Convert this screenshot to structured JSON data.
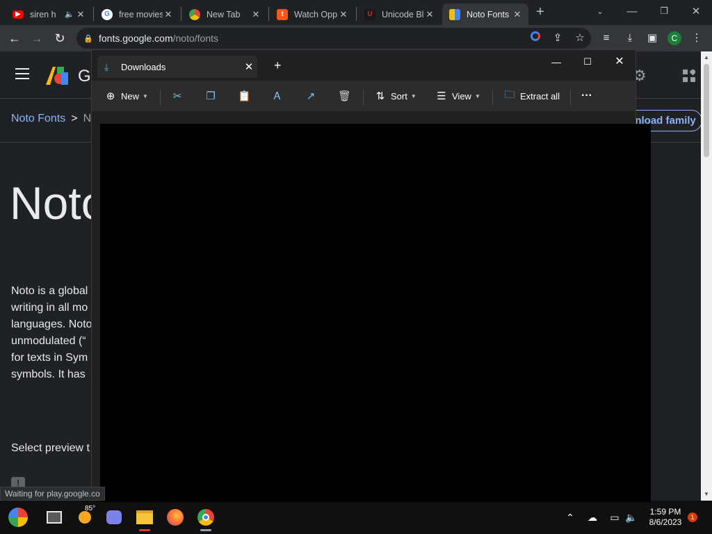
{
  "browser": {
    "tabs": [
      {
        "title": "siren h",
        "favicon": "youtube-icon",
        "muted": true
      },
      {
        "title": "free movies",
        "favicon": "google-icon"
      },
      {
        "title": "New Tab",
        "favicon": "chrome-icon"
      },
      {
        "title": "Watch Opp",
        "favicon": "tubi-icon"
      },
      {
        "title": "Unicode Bl",
        "favicon": "unicode-icon"
      },
      {
        "title": "Noto Fonts",
        "favicon": "google-fonts-icon",
        "active": true
      }
    ],
    "url_host": "fonts.google.com",
    "url_path": "/noto/fonts",
    "profile_initial": "C"
  },
  "page": {
    "logo_text": "G",
    "breadcrumb_root": "Noto Fonts",
    "breadcrumb_sep": ">",
    "breadcrumb_next": "N",
    "download_family": "ynload family",
    "title": "Noto",
    "description_lines": [
      "Noto is a global",
      "writing in all mo",
      "languages. Noto",
      "unmodulated (“",
      "for texts in Sym",
      "symbols. It has"
    ],
    "select_preview": "Select preview t",
    "status_text": "Waiting for play.google.co"
  },
  "explorer": {
    "tab_title": "Downloads",
    "new_label": "New",
    "sort_label": "Sort",
    "view_label": "View",
    "extract_label": "Extract all",
    "more_label": "···",
    "accent": "#3ab0e0"
  },
  "taskbar": {
    "weather_temp": "85°",
    "time": "1:59 PM",
    "date": "8/6/2023",
    "notifications": "1"
  }
}
